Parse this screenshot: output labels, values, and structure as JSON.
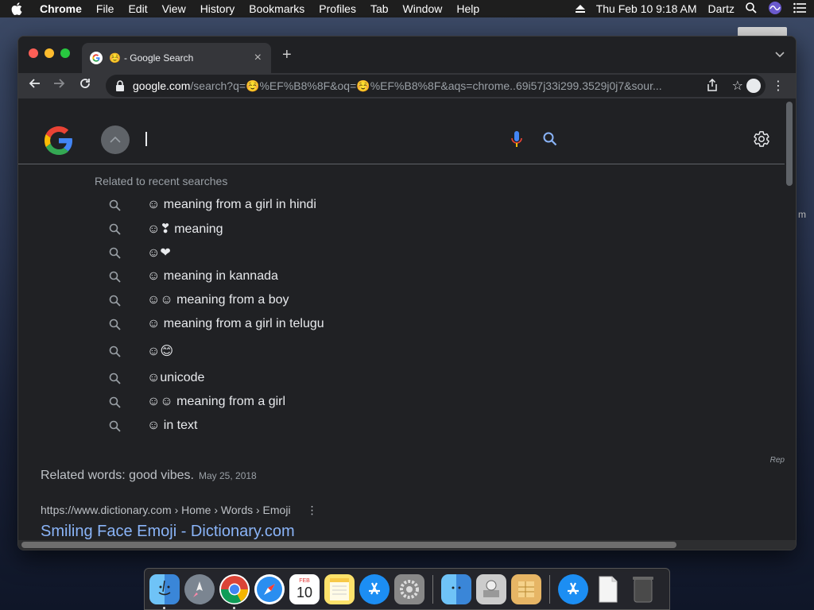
{
  "menubar": {
    "app": "Chrome",
    "items": [
      "File",
      "Edit",
      "View",
      "History",
      "Bookmarks",
      "Profiles",
      "Tab",
      "Window",
      "Help"
    ],
    "datetime": "Thu Feb 10  9:18 AM",
    "user": "Dartz"
  },
  "desktop": {
    "peek_text": "m"
  },
  "browser": {
    "tab": {
      "emoji": "☺️",
      "title": "- Google Search"
    },
    "url": {
      "host": "google.com",
      "path": "/search?q=☺️%EF%B8%8F&oq=☺️%EF%B8%8F&aqs=chrome..69i57j33i299.3529j0j7&sour..."
    }
  },
  "search": {
    "related_title": "Related to recent searches",
    "suggestions": [
      "☺ meaning from a girl in hindi",
      "☺❣ meaning",
      "☺❤",
      "☺ meaning in kannada",
      "☺☺ meaning from a boy",
      "☺ meaning from a girl in telugu",
      "☺😊",
      "☺unicode",
      "☺☺ meaning from a girl",
      "☺ in text"
    ],
    "related_words": "Related words: good vibes.",
    "related_date": "May 25, 2018",
    "rep_text": "Rep",
    "cite": "https://www.dictionary.com › Home › Words › Emoji",
    "result_title": "Smiling Face Emoji - Dictionary.com"
  },
  "dock": {
    "items": [
      "finder-icon",
      "launchpad-icon",
      "chrome-icon",
      "safari-icon",
      "calendar-icon",
      "notes-icon",
      "app-store-icon",
      "system-preferences-icon",
      "migration-assistant-icon",
      "disk-utility-icon",
      "numbers-icon",
      "app-store-downloads-icon",
      "document-icon",
      "trash-icon"
    ],
    "calendar_month": "FEB",
    "calendar_day": "10"
  },
  "colors": {
    "page_bg": "#202124",
    "link_blue": "#8ab4f8",
    "muted_text": "#9aa0a6"
  }
}
